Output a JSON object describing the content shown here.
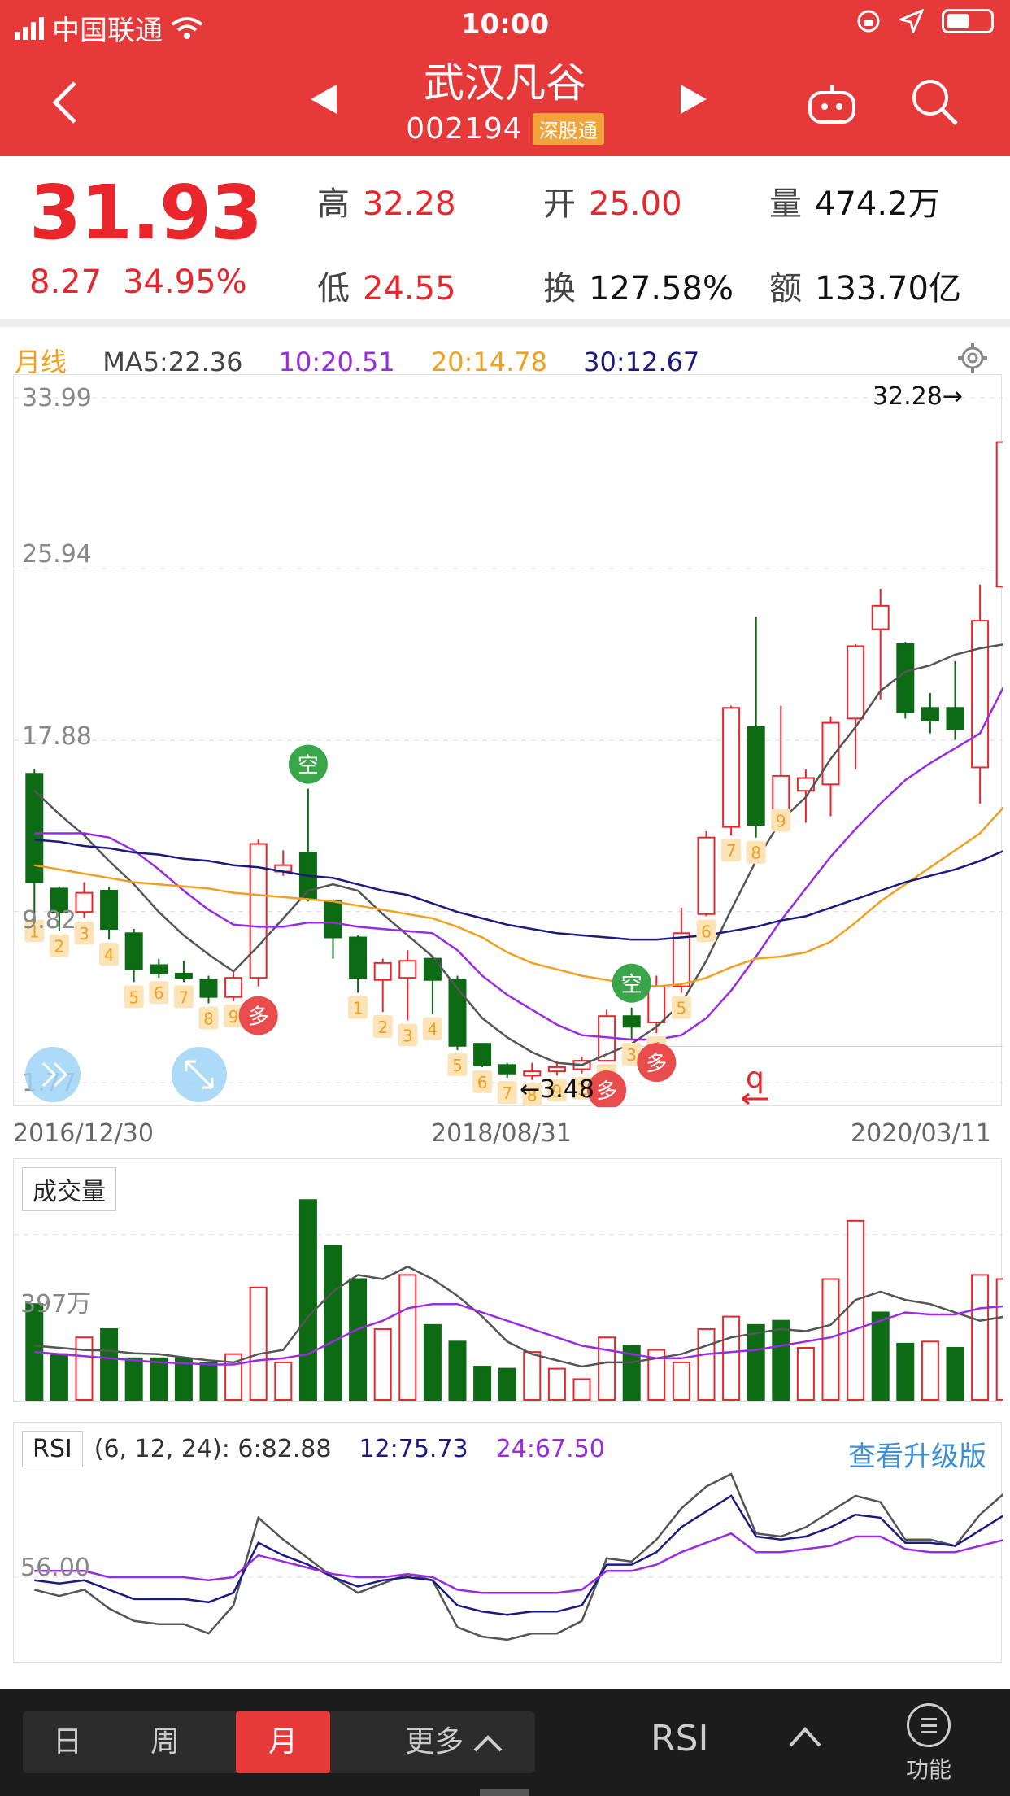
{
  "status": {
    "carrier": "中国联通",
    "time": "10:00"
  },
  "header": {
    "name": "武汉凡谷",
    "code": "002194",
    "badge": "深股通"
  },
  "quote": {
    "price": "31.93",
    "change": "8.27",
    "change_pct": "34.95%",
    "high_label": "高",
    "high": "32.28",
    "low_label": "低",
    "low": "24.55",
    "open_label": "开",
    "open": "25.00",
    "turnover_label": "换",
    "turnover": "127.58%",
    "volume_label": "量",
    "volume": "474.2万",
    "amount_label": "额",
    "amount": "133.70亿"
  },
  "ma": {
    "period": "月线",
    "ma5": "MA5:22.36",
    "ma10": "10:20.51",
    "ma20": "20:14.78",
    "ma30": "30:12.67"
  },
  "colors": {
    "up": "#e8262c",
    "down": "#0d6b14",
    "ma5": "#555555",
    "ma10": "#9a2be0",
    "ma20": "#f0a020",
    "ma30": "#1a1a80",
    "accent": "#e5393a"
  },
  "chart": {
    "y_ticks": [
      "33.99",
      "25.94",
      "17.88",
      "9.82",
      "1.77"
    ],
    "max_label": "32.28→",
    "min_label": "←3.48",
    "dates": {
      "start": "2016/12/30",
      "mid": "2018/08/31",
      "end": "2020/03/11"
    },
    "vol_label": "成交量",
    "vol_tick": "397万",
    "rsi_label": "RSI",
    "rsi_params": "(6, 12, 24): 6:82.88",
    "rsi12": "12:75.73",
    "rsi24": "24:67.50",
    "rsi_tick": "56.00",
    "upgrade": "查看升级版"
  },
  "chart_data": {
    "type": "candlestick",
    "title": "",
    "ylim": [
      1.77,
      33.99
    ],
    "y_ticks": [
      33.99,
      25.94,
      17.88,
      9.82,
      1.77
    ],
    "x_labels": [
      "2016/12/30",
      "2018/08/31",
      "2020/03/11"
    ],
    "candles": [
      {
        "o": 16.3,
        "c": 11.2,
        "h": 16.5,
        "l": 9.6
      },
      {
        "o": 10.9,
        "c": 9.8,
        "h": 11.0,
        "l": 8.9
      },
      {
        "o": 9.8,
        "c": 10.7,
        "h": 11.2,
        "l": 9.5
      },
      {
        "o": 10.8,
        "c": 9.0,
        "h": 11.0,
        "l": 8.5
      },
      {
        "o": 8.8,
        "c": 7.1,
        "h": 9.0,
        "l": 6.5
      },
      {
        "o": 7.3,
        "c": 6.9,
        "h": 7.6,
        "l": 6.7
      },
      {
        "o": 6.9,
        "c": 6.7,
        "h": 7.5,
        "l": 6.5
      },
      {
        "o": 6.6,
        "c": 5.8,
        "h": 6.8,
        "l": 5.5
      },
      {
        "o": 5.8,
        "c": 6.7,
        "h": 7.0,
        "l": 5.6
      },
      {
        "o": 6.7,
        "c": 13.0,
        "h": 13.2,
        "l": 6.3
      },
      {
        "o": 11.7,
        "c": 12.0,
        "h": 12.7,
        "l": 11.5
      },
      {
        "o": 12.6,
        "c": 10.4,
        "h": 15.6,
        "l": 10.3
      },
      {
        "o": 10.3,
        "c": 8.6,
        "h": 10.4,
        "l": 7.6
      },
      {
        "o": 8.6,
        "c": 6.7,
        "h": 8.7,
        "l": 6.0
      },
      {
        "o": 6.6,
        "c": 7.4,
        "h": 7.6,
        "l": 5.1
      },
      {
        "o": 6.7,
        "c": 7.5,
        "h": 8.0,
        "l": 4.7
      },
      {
        "o": 7.6,
        "c": 6.6,
        "h": 7.7,
        "l": 5.0
      },
      {
        "o": 6.6,
        "c": 3.5,
        "h": 6.8,
        "l": 3.3
      },
      {
        "o": 3.6,
        "c": 2.6,
        "h": 3.6,
        "l": 2.5
      },
      {
        "o": 2.6,
        "c": 2.2,
        "h": 2.7,
        "l": 2.0
      },
      {
        "o": 2.1,
        "c": 2.3,
        "h": 2.7,
        "l": 1.9
      },
      {
        "o": 2.3,
        "c": 2.5,
        "h": 2.8,
        "l": 2.1
      },
      {
        "o": 2.4,
        "c": 2.8,
        "h": 3.0,
        "l": 2.2
      },
      {
        "o": 2.8,
        "c": 4.9,
        "h": 5.2,
        "l": 2.8
      },
      {
        "o": 4.9,
        "c": 4.4,
        "h": 5.3,
        "l": 3.8
      },
      {
        "o": 4.6,
        "c": 6.3,
        "h": 6.8,
        "l": 4.1
      },
      {
        "o": 6.3,
        "c": 8.8,
        "h": 10.0,
        "l": 6.0
      },
      {
        "o": 9.7,
        "c": 13.3,
        "h": 13.6,
        "l": 9.6
      },
      {
        "o": 13.8,
        "c": 19.4,
        "h": 19.5,
        "l": 13.4
      },
      {
        "o": 18.5,
        "c": 13.9,
        "h": 23.7,
        "l": 13.3
      },
      {
        "o": 14.5,
        "c": 16.2,
        "h": 19.5,
        "l": 14.8
      },
      {
        "o": 15.5,
        "c": 16.1,
        "h": 16.5,
        "l": 14.0
      },
      {
        "o": 15.8,
        "c": 18.7,
        "h": 19.0,
        "l": 14.3
      },
      {
        "o": 18.9,
        "c": 22.3,
        "h": 22.4,
        "l": 16.5
      },
      {
        "o": 23.1,
        "c": 24.2,
        "h": 25.0,
        "l": 19.8
      },
      {
        "o": 22.4,
        "c": 19.2,
        "h": 22.5,
        "l": 18.9
      },
      {
        "o": 19.4,
        "c": 18.8,
        "h": 20.1,
        "l": 18.2
      },
      {
        "o": 19.4,
        "c": 18.4,
        "h": 21.6,
        "l": 17.9
      },
      {
        "o": 16.6,
        "c": 23.5,
        "h": 25.2,
        "l": 14.9
      },
      {
        "o": 25.1,
        "c": 31.9,
        "h": 32.3,
        "l": 24.6
      }
    ],
    "series": [
      {
        "name": "MA5",
        "values": [
          15.5,
          14.4,
          13.4,
          12.2,
          11.1,
          9.8,
          8.7,
          7.8,
          7.0,
          8.2,
          9.5,
          10.8,
          11.1,
          10.8,
          9.7,
          8.7,
          7.7,
          6.2,
          4.8,
          3.9,
          3.2,
          2.7,
          2.6,
          3.1,
          3.6,
          4.4,
          5.5,
          7.5,
          9.9,
          12.2,
          14.1,
          15.2,
          17.0,
          18.5,
          20.2,
          21.1,
          21.4,
          21.9,
          22.2,
          22.4
        ]
      },
      {
        "name": "10",
        "values": [
          13.5,
          13.5,
          13.5,
          13.3,
          12.7,
          11.8,
          10.8,
          9.9,
          9.2,
          9.1,
          9.1,
          9.3,
          9.3,
          9.1,
          9.0,
          8.9,
          8.8,
          8.0,
          6.8,
          5.9,
          5.2,
          4.5,
          4.0,
          3.9,
          3.8,
          3.8,
          4.0,
          4.8,
          6.1,
          7.7,
          9.4,
          10.9,
          12.4,
          13.7,
          14.9,
          16.0,
          16.8,
          17.5,
          18.2,
          20.5
        ]
      },
      {
        "name": "20",
        "values": [
          12.0,
          11.8,
          11.6,
          11.4,
          11.2,
          11.1,
          11.0,
          10.9,
          10.7,
          10.6,
          10.5,
          10.4,
          10.3,
          10.1,
          9.9,
          9.7,
          9.5,
          9.1,
          8.6,
          7.9,
          7.4,
          7.1,
          6.8,
          6.6,
          6.4,
          6.3,
          6.4,
          6.7,
          7.2,
          7.6,
          7.7,
          7.9,
          8.4,
          9.3,
          10.3,
          11.1,
          11.9,
          12.7,
          13.5,
          14.8
        ]
      },
      {
        "name": "30",
        "values": [
          13.2,
          13.1,
          12.9,
          12.8,
          12.6,
          12.5,
          12.3,
          12.2,
          12.0,
          11.9,
          11.7,
          11.5,
          11.4,
          11.1,
          10.8,
          10.6,
          10.2,
          9.8,
          9.5,
          9.2,
          9.0,
          8.8,
          8.7,
          8.6,
          8.5,
          8.5,
          8.6,
          8.7,
          8.9,
          9.1,
          9.4,
          9.6,
          10.0,
          10.4,
          10.8,
          11.2,
          11.5,
          11.8,
          12.2,
          12.7
        ]
      }
    ],
    "volume": [
      {
        "v": 230,
        "up": false
      },
      {
        "v": 110,
        "up": false
      },
      {
        "v": 150,
        "up": true
      },
      {
        "v": 170,
        "up": false
      },
      {
        "v": 100,
        "up": false
      },
      {
        "v": 100,
        "up": false
      },
      {
        "v": 100,
        "up": false
      },
      {
        "v": 90,
        "up": false
      },
      {
        "v": 110,
        "up": true
      },
      {
        "v": 270,
        "up": true
      },
      {
        "v": 90,
        "up": true
      },
      {
        "v": 480,
        "up": false
      },
      {
        "v": 370,
        "up": false
      },
      {
        "v": 290,
        "up": false
      },
      {
        "v": 170,
        "up": true
      },
      {
        "v": 300,
        "up": true
      },
      {
        "v": 180,
        "up": false
      },
      {
        "v": 140,
        "up": false
      },
      {
        "v": 80,
        "up": false
      },
      {
        "v": 75,
        "up": false
      },
      {
        "v": 115,
        "up": true
      },
      {
        "v": 75,
        "up": true
      },
      {
        "v": 50,
        "up": true
      },
      {
        "v": 150,
        "up": true
      },
      {
        "v": 130,
        "up": false
      },
      {
        "v": 120,
        "up": true
      },
      {
        "v": 90,
        "up": true
      },
      {
        "v": 170,
        "up": true
      },
      {
        "v": 200,
        "up": true
      },
      {
        "v": 180,
        "up": false
      },
      {
        "v": 190,
        "up": false
      },
      {
        "v": 125,
        "up": true
      },
      {
        "v": 290,
        "up": true
      },
      {
        "v": 430,
        "up": true
      },
      {
        "v": 210,
        "up": false
      },
      {
        "v": 135,
        "up": false
      },
      {
        "v": 140,
        "up": true
      },
      {
        "v": 125,
        "up": false
      },
      {
        "v": 300,
        "up": true
      },
      {
        "v": 290,
        "up": true
      }
    ],
    "vol_series": [
      {
        "name": "vol_ma5",
        "values": [
          130,
          125,
          120,
          118,
          112,
          110,
          102,
          95,
          90,
          110,
          120,
          200,
          260,
          300,
          290,
          320,
          290,
          250,
          200,
          140,
          110,
          95,
          80,
          90,
          90,
          100,
          110,
          130,
          150,
          160,
          170,
          165,
          180,
          240,
          260,
          240,
          230,
          210,
          190,
          200
        ]
      },
      {
        "name": "vol_ma10",
        "values": [
          115,
          110,
          105,
          100,
          95,
          90,
          88,
          85,
          85,
          95,
          100,
          110,
          140,
          170,
          190,
          220,
          230,
          230,
          210,
          190,
          170,
          150,
          130,
          120,
          110,
          100,
          100,
          110,
          115,
          120,
          130,
          140,
          150,
          170,
          190,
          210,
          205,
          205,
          220,
          225
        ]
      }
    ],
    "rsi": [
      {
        "name": "6",
        "values": [
          52,
          50,
          52,
          46,
          42,
          41,
          41,
          38,
          47,
          75,
          68,
          62,
          56,
          51,
          54,
          57,
          55,
          40,
          37,
          36,
          38,
          38,
          42,
          62,
          61,
          68,
          78,
          85,
          89,
          70,
          69,
          72,
          77,
          82,
          80,
          68,
          68,
          66,
          76,
          83
        ]
      },
      {
        "name": "12",
        "values": [
          55,
          54,
          55,
          52,
          49,
          49,
          49,
          48,
          51,
          67,
          63,
          60,
          56,
          53,
          55,
          56,
          55,
          47,
          45,
          44,
          45,
          45,
          47,
          60,
          60,
          64,
          72,
          77,
          82,
          69,
          68,
          69,
          72,
          76,
          75,
          67,
          67,
          66,
          71,
          76
        ]
      },
      {
        "name": "24",
        "values": [
          58,
          58,
          58,
          56,
          56,
          56,
          56,
          55,
          56,
          63,
          61,
          59,
          57,
          56,
          56,
          57,
          56,
          52,
          51,
          51,
          51,
          51,
          52,
          58,
          58,
          60,
          64,
          67,
          70,
          64,
          64,
          65,
          66,
          69,
          69,
          65,
          64,
          64,
          66,
          68
        ]
      }
    ],
    "tags": [
      {
        "i": 0,
        "t": "1"
      },
      {
        "i": 1,
        "t": "2"
      },
      {
        "i": 2,
        "t": "3"
      },
      {
        "i": 3,
        "t": "4"
      },
      {
        "i": 4,
        "t": "5"
      },
      {
        "i": 5,
        "t": "6"
      },
      {
        "i": 6,
        "t": "7"
      },
      {
        "i": 7,
        "t": "8"
      },
      {
        "i": 8,
        "t": "9"
      },
      {
        "i": 13,
        "t": "1"
      },
      {
        "i": 14,
        "t": "2"
      },
      {
        "i": 15,
        "t": "3"
      },
      {
        "i": 16,
        "t": "4"
      },
      {
        "i": 17,
        "t": "5"
      },
      {
        "i": 18,
        "t": "6"
      },
      {
        "i": 19,
        "t": "7"
      },
      {
        "i": 20,
        "t": "8"
      },
      {
        "i": 21,
        "t": "9"
      },
      {
        "i": 22,
        "t": "1"
      },
      {
        "i": 23,
        "t": "2"
      },
      {
        "i": 24,
        "t": "3"
      },
      {
        "i": 25,
        "t": "4"
      },
      {
        "i": 26,
        "t": "5"
      },
      {
        "i": 27,
        "t": "6"
      },
      {
        "i": 28,
        "t": "7"
      },
      {
        "i": 29,
        "t": "8"
      },
      {
        "i": 30,
        "t": "9"
      }
    ],
    "signals": [
      {
        "i": 11,
        "t": "空",
        "kind": "short"
      },
      {
        "i": 9,
        "t": "多",
        "kind": "long"
      },
      {
        "i": 23,
        "t": "多",
        "kind": "long"
      },
      {
        "i": 24,
        "t": "空",
        "kind": "short"
      },
      {
        "i": 25,
        "t": "多",
        "kind": "long"
      }
    ]
  },
  "bottom": {
    "day": "日",
    "week": "周",
    "month": "月",
    "more": "更多",
    "indicator": "RSI",
    "func": "功能"
  }
}
